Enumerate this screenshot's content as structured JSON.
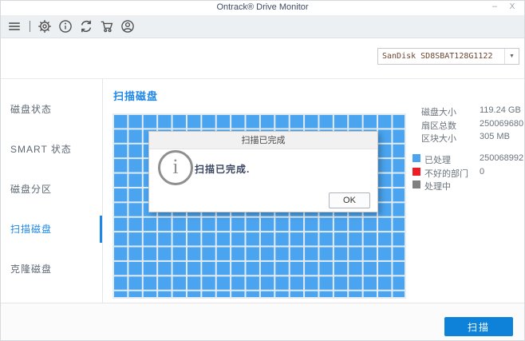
{
  "window": {
    "title": "Ontrack® Drive Monitor",
    "minimize_label": "–",
    "close_label": "X"
  },
  "toolbar": {
    "icons": [
      "menu-icon",
      "settings-gear-icon",
      "info-icon",
      "refresh-icon",
      "cart-icon",
      "account-icon"
    ]
  },
  "drive_selector": {
    "value": "SanDisk SD8SBAT128G1122",
    "arrow": "▼"
  },
  "sidebar": {
    "items": [
      {
        "label": "磁盘状态",
        "active": false
      },
      {
        "label": "SMART 状态",
        "active": false
      },
      {
        "label": "磁盘分区",
        "active": false
      },
      {
        "label": "扫描磁盘",
        "active": true
      },
      {
        "label": "克隆磁盘",
        "active": false
      }
    ]
  },
  "main": {
    "title": "扫描磁盘"
  },
  "scan_grid": {
    "columns": 20,
    "rows": 13,
    "cell_color": "#4aa4ef",
    "state": "all_processed"
  },
  "stats": {
    "rows": [
      {
        "label": "磁盘大小",
        "value": "119.24 GB"
      },
      {
        "label": "扇区总数",
        "value": "250069680"
      },
      {
        "label": "区块大小",
        "value": "305 MB"
      }
    ]
  },
  "legend": {
    "items": [
      {
        "label": "已处理",
        "value": "250068992",
        "color": "#4aa4ef"
      },
      {
        "label": "不好的部门",
        "value": "0",
        "color": "#ee1c25"
      },
      {
        "label": "处理中",
        "value": "",
        "color": "#808080"
      }
    ]
  },
  "dialog": {
    "title": "扫描已完成",
    "message": "扫描已完成.",
    "ok_label": "OK"
  },
  "actions": {
    "scan_label": "扫描"
  },
  "colors": {
    "accent_blue": "#1d87e8",
    "button_blue": "#0e82d9",
    "grid_blue": "#4aa4ef",
    "bad_red": "#ee1c25",
    "processing_gray": "#808080"
  }
}
